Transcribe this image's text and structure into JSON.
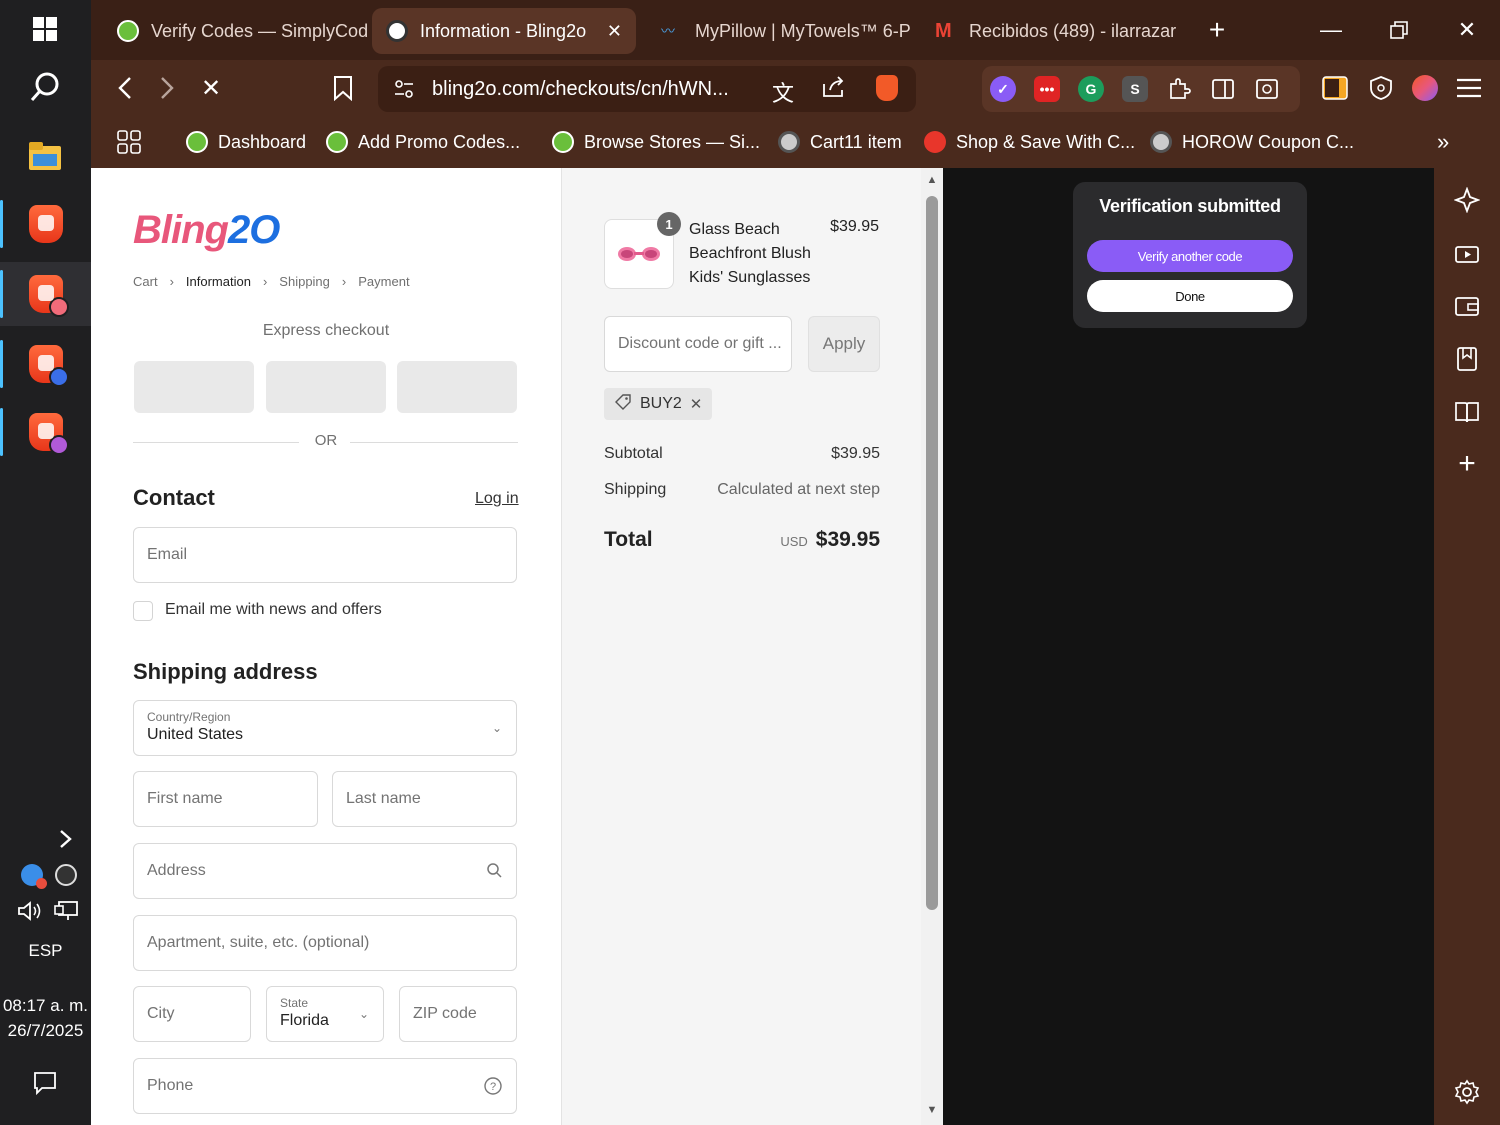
{
  "taskbar": {
    "language": "ESP",
    "time": "08:17 a. m.",
    "date": "26/7/2025"
  },
  "tabs": [
    {
      "title": "Verify Codes — SimplyCod",
      "active": false
    },
    {
      "title": "Information - Bling2o",
      "active": true
    },
    {
      "title": "MyPillow | MyTowels™ 6-P",
      "active": false
    },
    {
      "title": "Recibidos (489) - ilarrazar",
      "active": false
    }
  ],
  "address_bar": {
    "url": "bling2o.com/checkouts/cn/hWN..."
  },
  "bookmarks": [
    {
      "label": "Dashboard"
    },
    {
      "label": "Add Promo Codes..."
    },
    {
      "label": "Browse Stores — Si..."
    },
    {
      "label": "Cart11 item"
    },
    {
      "label": "Shop & Save With C..."
    },
    {
      "label": "HOROW Coupon C..."
    }
  ],
  "checkout": {
    "logo": {
      "main": "Bling",
      "accent": "2O"
    },
    "breadcrumb": [
      "Cart",
      "Information",
      "Shipping",
      "Payment"
    ],
    "express_label": "Express checkout",
    "or_label": "OR",
    "contact_heading": "Contact",
    "login_link": "Log in",
    "email_placeholder": "Email",
    "newsletter_label": "Email me with news and offers",
    "shipping_heading": "Shipping address",
    "country_label": "Country/Region",
    "country_value": "United States",
    "first_name_placeholder": "First name",
    "last_name_placeholder": "Last name",
    "address_placeholder": "Address",
    "apartment_placeholder": "Apartment, suite, etc. (optional)",
    "city_placeholder": "City",
    "state_label": "State",
    "state_value": "Florida",
    "zip_placeholder": "ZIP code",
    "phone_placeholder": "Phone"
  },
  "summary": {
    "product": {
      "quantity": "1",
      "name": "Glass Beach Beachfront Blush Kids' Sunglasses",
      "price": "$39.95"
    },
    "discount_placeholder": "Discount code or gift ...",
    "apply_label": "Apply",
    "applied_code": "BUY2",
    "subtotal_label": "Subtotal",
    "subtotal_value": "$39.95",
    "shipping_label": "Shipping",
    "shipping_value": "Calculated at next step",
    "total_label": "Total",
    "total_currency": "USD",
    "total_value": "$39.95"
  },
  "popup": {
    "title": "Verification submitted",
    "verify_another_label": "Verify another code",
    "done_label": "Done"
  },
  "colors": {
    "chrome": "#4a2a1d",
    "tabstrip": "#3a2016",
    "accent_purple": "#8a5cf6",
    "brand_pink": "#e8577b",
    "brand_blue": "#1d6fe0"
  }
}
